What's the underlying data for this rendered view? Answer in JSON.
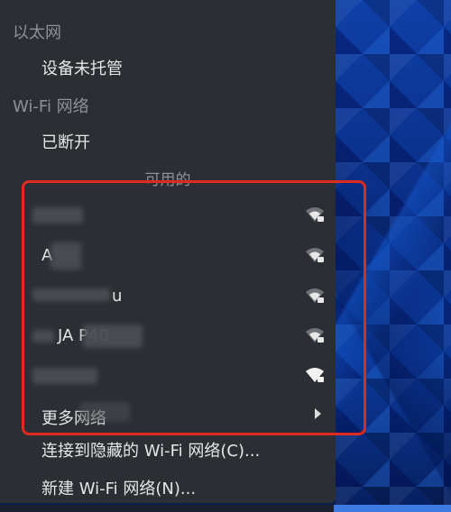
{
  "menu": {
    "ethernet_header": "以太网",
    "ethernet_status": "设备未托管",
    "wifi_header": "Wi-Fi 网络",
    "wifi_status": "已断开",
    "available_header": "可用的",
    "networks": [
      {
        "name": "",
        "icon": "wifi-secured-icon",
        "strong": false
      },
      {
        "name": "A",
        "icon": "wifi-secured-icon",
        "strong": false
      },
      {
        "name": "u",
        "icon": "wifi-secured-icon",
        "strong": false
      },
      {
        "name": "JA        P40",
        "icon": "wifi-secured-icon",
        "strong": false
      },
      {
        "name": "",
        "icon": "wifi-secured-icon",
        "strong": true
      }
    ],
    "more_networks": "更多网络",
    "connect_hidden": "连接到隐藏的 Wi-Fi 网络(C)...",
    "new_network": "新建 Wi-Fi 网络(N)..."
  },
  "colors": {
    "menu_bg": "#2b2f34",
    "highlight_border": "#e02a1f",
    "desktop_accent": "#0e3fa8"
  }
}
